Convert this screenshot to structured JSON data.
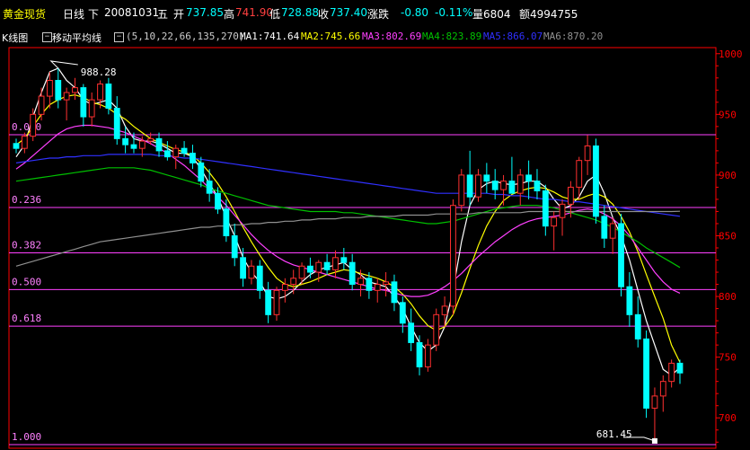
{
  "header": {
    "name": "黄金现货",
    "period": "日线",
    "nav": "下",
    "date": "20081031",
    "weekday": "五",
    "open_label": "开",
    "open_value": "737.85",
    "high_label": "高",
    "high_value": "741.90",
    "low_label": "低",
    "low_value": "728.88",
    "close_label": "收",
    "close_value": "737.40",
    "change_label": "涨跌",
    "change_value": "-0.80",
    "change_pct": "-0.11%",
    "volume_text": "量6804",
    "amount_text": "额4994755"
  },
  "indicator": {
    "kline_tab": "K线图",
    "ma_tab": "移动平均线",
    "params": "(5,10,22,66,135,270)",
    "ma1": "MA1:741.64",
    "ma2": "MA2:745.66",
    "ma3": "MA3:802.69",
    "ma4": "MA4:823.89",
    "ma5": "MA5:866.07",
    "ma6": "MA6:870.20",
    "colors": {
      "ma1": "#ffffff",
      "ma2": "#ffff00",
      "ma3": "#ff40ff",
      "ma4": "#00c000",
      "ma5": "#3030ff",
      "ma6": "#909090"
    }
  },
  "chart_data": {
    "type": "candlestick",
    "ylim": [
      675,
      1005
    ],
    "y_ticks": [
      "1000",
      "950",
      "900",
      "850",
      "800",
      "750",
      "700"
    ],
    "fib_levels": [
      {
        "label": "0.000",
        "price": 933.2
      },
      {
        "label": "0.236",
        "price": 873.3
      },
      {
        "label": "0.382",
        "price": 835.9
      },
      {
        "label": "0.500",
        "price": 805.7
      },
      {
        "label": "0.618",
        "price": 775.5
      },
      {
        "label": "1.000",
        "price": 678.0
      }
    ],
    "annotations": [
      {
        "text": "988.28",
        "price": 988.28
      },
      {
        "text": "681.45",
        "price": 681.45
      }
    ],
    "series_colors": {
      "up": "#ff3030",
      "down": "#00ffff",
      "fib": "#ff40ff",
      "axis": "#ff0000"
    },
    "candles": [
      [
        926,
        930,
        918,
        922
      ],
      [
        922,
        935,
        918,
        932
      ],
      [
        932,
        955,
        928,
        950
      ],
      [
        950,
        972,
        945,
        965
      ],
      [
        965,
        985,
        955,
        978
      ],
      [
        978,
        988,
        955,
        962
      ],
      [
        962,
        972,
        945,
        968
      ],
      [
        968,
        980,
        962,
        972
      ],
      [
        972,
        975,
        940,
        948
      ],
      [
        948,
        968,
        940,
        962
      ],
      [
        962,
        978,
        955,
        975
      ],
      [
        975,
        980,
        950,
        955
      ],
      [
        955,
        965,
        925,
        930
      ],
      [
        930,
        940,
        918,
        925
      ],
      [
        925,
        935,
        918,
        922
      ],
      [
        922,
        932,
        915,
        928
      ],
      [
        928,
        935,
        925,
        930
      ],
      [
        930,
        935,
        915,
        920
      ],
      [
        920,
        928,
        912,
        915
      ],
      [
        915,
        925,
        905,
        922
      ],
      [
        922,
        928,
        915,
        918
      ],
      [
        918,
        925,
        905,
        910
      ],
      [
        910,
        915,
        890,
        895
      ],
      [
        895,
        905,
        878,
        885
      ],
      [
        885,
        890,
        868,
        872
      ],
      [
        872,
        880,
        845,
        850
      ],
      [
        850,
        860,
        825,
        832
      ],
      [
        832,
        840,
        808,
        815
      ],
      [
        815,
        830,
        810,
        825
      ],
      [
        825,
        830,
        798,
        805
      ],
      [
        805,
        812,
        778,
        785
      ],
      [
        785,
        808,
        780,
        805
      ],
      [
        805,
        815,
        795,
        810
      ],
      [
        810,
        822,
        802,
        815
      ],
      [
        815,
        828,
        810,
        825
      ],
      [
        825,
        832,
        815,
        820
      ],
      [
        820,
        830,
        812,
        828
      ],
      [
        828,
        835,
        818,
        822
      ],
      [
        822,
        838,
        815,
        832
      ],
      [
        832,
        840,
        822,
        828
      ],
      [
        828,
        835,
        805,
        810
      ],
      [
        810,
        822,
        800,
        815
      ],
      [
        815,
        820,
        798,
        805
      ],
      [
        805,
        815,
        795,
        810
      ],
      [
        810,
        820,
        800,
        812
      ],
      [
        812,
        818,
        788,
        795
      ],
      [
        795,
        800,
        770,
        778
      ],
      [
        778,
        790,
        755,
        762
      ],
      [
        762,
        768,
        735,
        742
      ],
      [
        742,
        765,
        738,
        760
      ],
      [
        760,
        790,
        755,
        785
      ],
      [
        785,
        800,
        775,
        792
      ],
      [
        792,
        880,
        785,
        875
      ],
      [
        875,
        905,
        870,
        900
      ],
      [
        900,
        920,
        875,
        882
      ],
      [
        882,
        905,
        878,
        900
      ],
      [
        900,
        910,
        885,
        895
      ],
      [
        895,
        905,
        880,
        888
      ],
      [
        888,
        900,
        875,
        895
      ],
      [
        895,
        915,
        885,
        885
      ],
      [
        885,
        905,
        875,
        900
      ],
      [
        900,
        912,
        880,
        895
      ],
      [
        895,
        905,
        880,
        887
      ],
      [
        887,
        892,
        850,
        858
      ],
      [
        858,
        870,
        838,
        865
      ],
      [
        865,
        880,
        850,
        876
      ],
      [
        876,
        895,
        865,
        890
      ],
      [
        890,
        915,
        880,
        912
      ],
      [
        912,
        933,
        900,
        924
      ],
      [
        924,
        930,
        860,
        866
      ],
      [
        866,
        875,
        840,
        848
      ],
      [
        848,
        865,
        835,
        860
      ],
      [
        860,
        868,
        800,
        808
      ],
      [
        808,
        820,
        775,
        785
      ],
      [
        785,
        800,
        758,
        765
      ],
      [
        765,
        772,
        700,
        708
      ],
      [
        708,
        725,
        681,
        718
      ],
      [
        718,
        735,
        705,
        730
      ],
      [
        730,
        748,
        725,
        745
      ],
      [
        745,
        748,
        728,
        737
      ]
    ],
    "ma_series": [
      {
        "name": "MA1",
        "color": "#ffffff",
        "values": [
          915,
          925,
          948,
          968,
          985,
          988,
          978,
          972,
          962,
          958,
          960,
          962,
          955,
          940,
          930,
          928,
          928,
          926,
          922,
          918,
          918,
          915,
          905,
          893,
          882,
          865,
          850,
          832,
          820,
          812,
          800,
          798,
          800,
          805,
          812,
          818,
          822,
          824,
          826,
          828,
          822,
          818,
          812,
          810,
          808,
          800,
          790,
          775,
          762,
          755,
          760,
          775,
          805,
          845,
          875,
          888,
          893,
          895,
          893,
          892,
          893,
          895,
          895,
          890,
          880,
          872,
          875,
          882,
          895,
          900,
          885,
          865,
          850,
          830,
          805,
          780,
          760,
          740,
          735,
          741.64
        ]
      },
      {
        "name": "MA2",
        "color": "#ffff00",
        "values": [
          925,
          930,
          940,
          950,
          958,
          962,
          965,
          966,
          964,
          960,
          958,
          955,
          950,
          946,
          940,
          935,
          930,
          927,
          924,
          921,
          919,
          916,
          910,
          902,
          893,
          882,
          870,
          857,
          845,
          834,
          824,
          815,
          810,
          808,
          810,
          812,
          815,
          818,
          820,
          822,
          821,
          819,
          817,
          815,
          812,
          808,
          802,
          794,
          784,
          776,
          772,
          775,
          785,
          803,
          823,
          842,
          858,
          870,
          879,
          884,
          887,
          889,
          890,
          889,
          886,
          882,
          880,
          880,
          883,
          885,
          882,
          876,
          866,
          853,
          837,
          818,
          800,
          782,
          760,
          745.66
        ]
      },
      {
        "name": "MA3",
        "color": "#ff40ff",
        "values": [
          905,
          910,
          916,
          922,
          928,
          934,
          938,
          940,
          941,
          941,
          940,
          939,
          937,
          935,
          932,
          929,
          926,
          922,
          918,
          913,
          908,
          902,
          896,
          889,
          882,
          875,
          867,
          859,
          851,
          844,
          838,
          833,
          829,
          826,
          824,
          822,
          820,
          818,
          816,
          814,
          812,
          810,
          808,
          806,
          805,
          803,
          801,
          800,
          800,
          801,
          804,
          808,
          813,
          819,
          826,
          833,
          839,
          845,
          850,
          855,
          859,
          862,
          864,
          865,
          866,
          867,
          869,
          871,
          872,
          871,
          868,
          864,
          858,
          850,
          840,
          830,
          820,
          812,
          806,
          802.69
        ]
      },
      {
        "name": "MA4",
        "color": "#00c000",
        "values": [
          895,
          896,
          897,
          898,
          899,
          900,
          901,
          902,
          903,
          904,
          905,
          906,
          906,
          906,
          906,
          905,
          904,
          902,
          900,
          898,
          896,
          894,
          892,
          889,
          887,
          885,
          883,
          881,
          879,
          877,
          875,
          874,
          873,
          872,
          871,
          870,
          870,
          870,
          870,
          869,
          869,
          868,
          867,
          866,
          865,
          864,
          863,
          862,
          861,
          860,
          860,
          861,
          862,
          864,
          866,
          868,
          870,
          872,
          873,
          874,
          875,
          875,
          875,
          874,
          873,
          871,
          869,
          867,
          865,
          863,
          860,
          857,
          853,
          849,
          845,
          840,
          836,
          832,
          828,
          823.89
        ]
      },
      {
        "name": "MA5",
        "color": "#3030ff",
        "values": [
          910,
          911,
          912,
          913,
          914,
          914,
          915,
          915,
          916,
          916,
          916,
          917,
          917,
          917,
          917,
          917,
          917,
          916,
          916,
          915,
          914,
          914,
          913,
          912,
          911,
          910,
          909,
          908,
          907,
          906,
          905,
          904,
          903,
          902,
          901,
          900,
          899,
          898,
          897,
          896,
          895,
          894,
          893,
          892,
          891,
          890,
          889,
          888,
          887,
          886,
          885,
          885,
          885,
          885,
          885,
          885,
          885,
          884,
          884,
          883,
          883,
          882,
          881,
          880,
          880,
          879,
          878,
          878,
          877,
          876,
          875,
          874,
          873,
          872,
          871,
          870,
          869,
          868,
          867,
          866.07
        ]
      },
      {
        "name": "MA6",
        "color": "#909090",
        "values": [
          825,
          827,
          829,
          831,
          833,
          835,
          837,
          839,
          841,
          843,
          845,
          846,
          847,
          848,
          849,
          850,
          851,
          852,
          853,
          854,
          855,
          856,
          857,
          857,
          858,
          858,
          859,
          859,
          860,
          860,
          861,
          861,
          862,
          862,
          863,
          863,
          864,
          864,
          864,
          865,
          865,
          865,
          866,
          866,
          866,
          866,
          867,
          867,
          867,
          867,
          868,
          868,
          868,
          868,
          868,
          869,
          869,
          869,
          869,
          869,
          869,
          870,
          870,
          870,
          870,
          870,
          870,
          870,
          870,
          870,
          870,
          870,
          870,
          870,
          870,
          870,
          870,
          870,
          870,
          870.2
        ]
      }
    ]
  }
}
